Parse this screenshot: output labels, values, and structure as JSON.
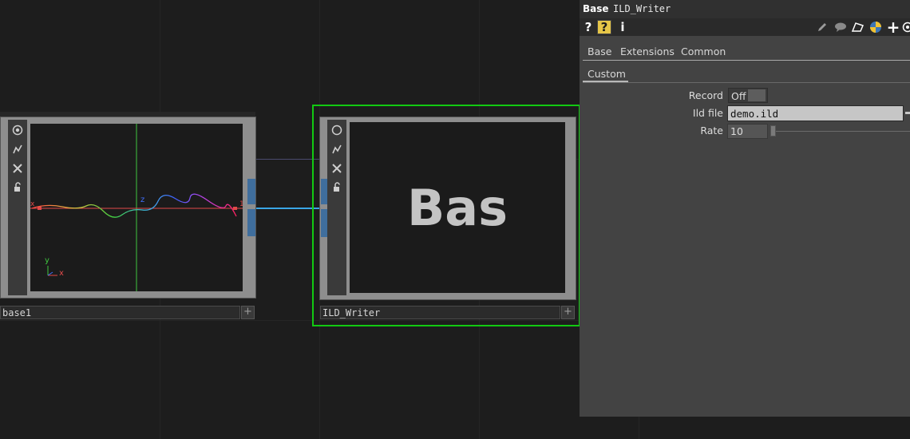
{
  "network": {
    "nodes": [
      {
        "name": "base1"
      },
      {
        "name": "ILD_Writer",
        "preview_text": "Bas"
      }
    ],
    "base1_viewer": {
      "axis_x": "x",
      "axis_y": "y",
      "axis_z": "z",
      "mark_left": "x",
      "mark_right": "1"
    }
  },
  "params_panel": {
    "op_type": "Base",
    "op_name": "ILD_Writer",
    "toolbar": {
      "help": "?",
      "python_help": "?",
      "info": "i"
    },
    "tabs_row1": [
      "Base",
      "Extensions",
      "Common"
    ],
    "tabs_row2": [
      "Custom"
    ],
    "active_tab": "Custom",
    "params": {
      "record": {
        "label": "Record",
        "value": "Off"
      },
      "ild_file": {
        "label": "Ild file",
        "value": "demo.ild"
      },
      "rate": {
        "label": "Rate",
        "value": "10"
      }
    }
  },
  "colors": {
    "selection": "#12c912",
    "wire": "#3aa6e6",
    "accent_blue": "#3f6e9d"
  }
}
